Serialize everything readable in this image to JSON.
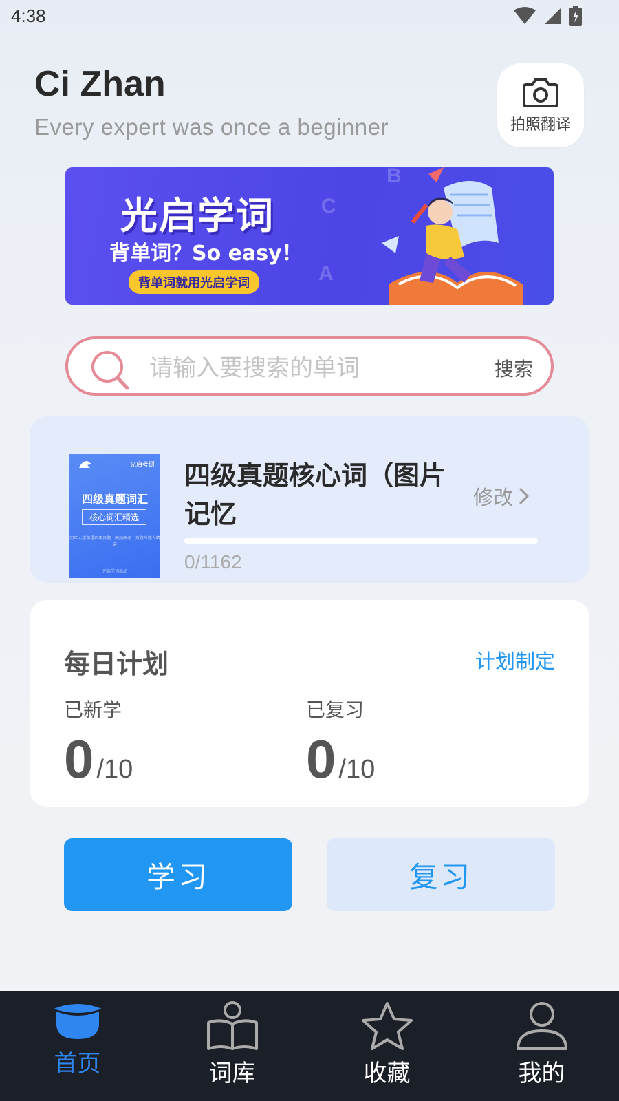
{
  "status_bar": {
    "time": "4:38"
  },
  "header": {
    "title": "Ci Zhan",
    "subtitle": "Every expert was once a beginner",
    "photo_translate_label": "拍照翻译"
  },
  "banner": {
    "title": "光启学词",
    "slogan": "背单词？So easy！",
    "tag": "背单词就用光启学词",
    "letters": [
      "B",
      "C",
      "A"
    ]
  },
  "search": {
    "placeholder": "请输入要搜索的单词",
    "value": "",
    "button_label": "搜索"
  },
  "current_book": {
    "title": "四级真题核心词（图片记忆",
    "edit_label": "修改",
    "progress_text": "0/1162",
    "progress_fraction": 0,
    "cover": {
      "brand": "光启考研",
      "title": "四级真题词汇",
      "subtitle": "核心词汇精选",
      "desc": "历年大学英语四级真题 · 高频高考 · 真题命题人精讲",
      "footer": "光启学词出品"
    }
  },
  "daily_plan": {
    "title": "每日计划",
    "link_label": "计划制定",
    "learned_label": "已新学",
    "learned_value": "0",
    "learned_total": "/10",
    "reviewed_label": "已复习",
    "reviewed_value": "0",
    "reviewed_total": "/10"
  },
  "actions": {
    "study_label": "学习",
    "review_label": "复习"
  },
  "tabbar": {
    "items": [
      {
        "label": "首页",
        "icon": "graduation-cap-icon",
        "active": true
      },
      {
        "label": "词库",
        "icon": "book-person-icon",
        "active": false
      },
      {
        "label": "收藏",
        "icon": "star-icon",
        "active": false
      },
      {
        "label": "我的",
        "icon": "user-icon",
        "active": false
      }
    ]
  },
  "colors": {
    "accent": "#2196f3",
    "tab_active": "#2f86f1",
    "tabbar_bg": "#1b1f27",
    "search_border": "#e58a97",
    "book_card_bg": "#e4ebfb"
  }
}
